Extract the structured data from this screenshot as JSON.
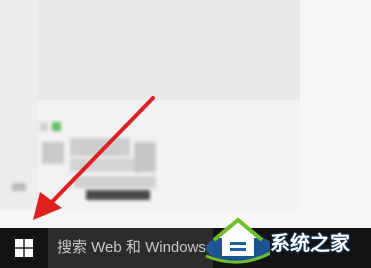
{
  "taskbar": {
    "start_icon": "windows-logo-icon",
    "search_placeholder": "搜索 Web 和 Windows"
  },
  "watermark": {
    "text": "系统之家",
    "logo_icon": "house-logo-icon"
  },
  "annotation": {
    "arrow_color": "#e02020",
    "arrow_icon": "red-arrow-pointing-to-start-button"
  },
  "colors": {
    "taskbar": "#131313",
    "search_box": "#2c2c2c",
    "accent_green": "#4caf50"
  }
}
